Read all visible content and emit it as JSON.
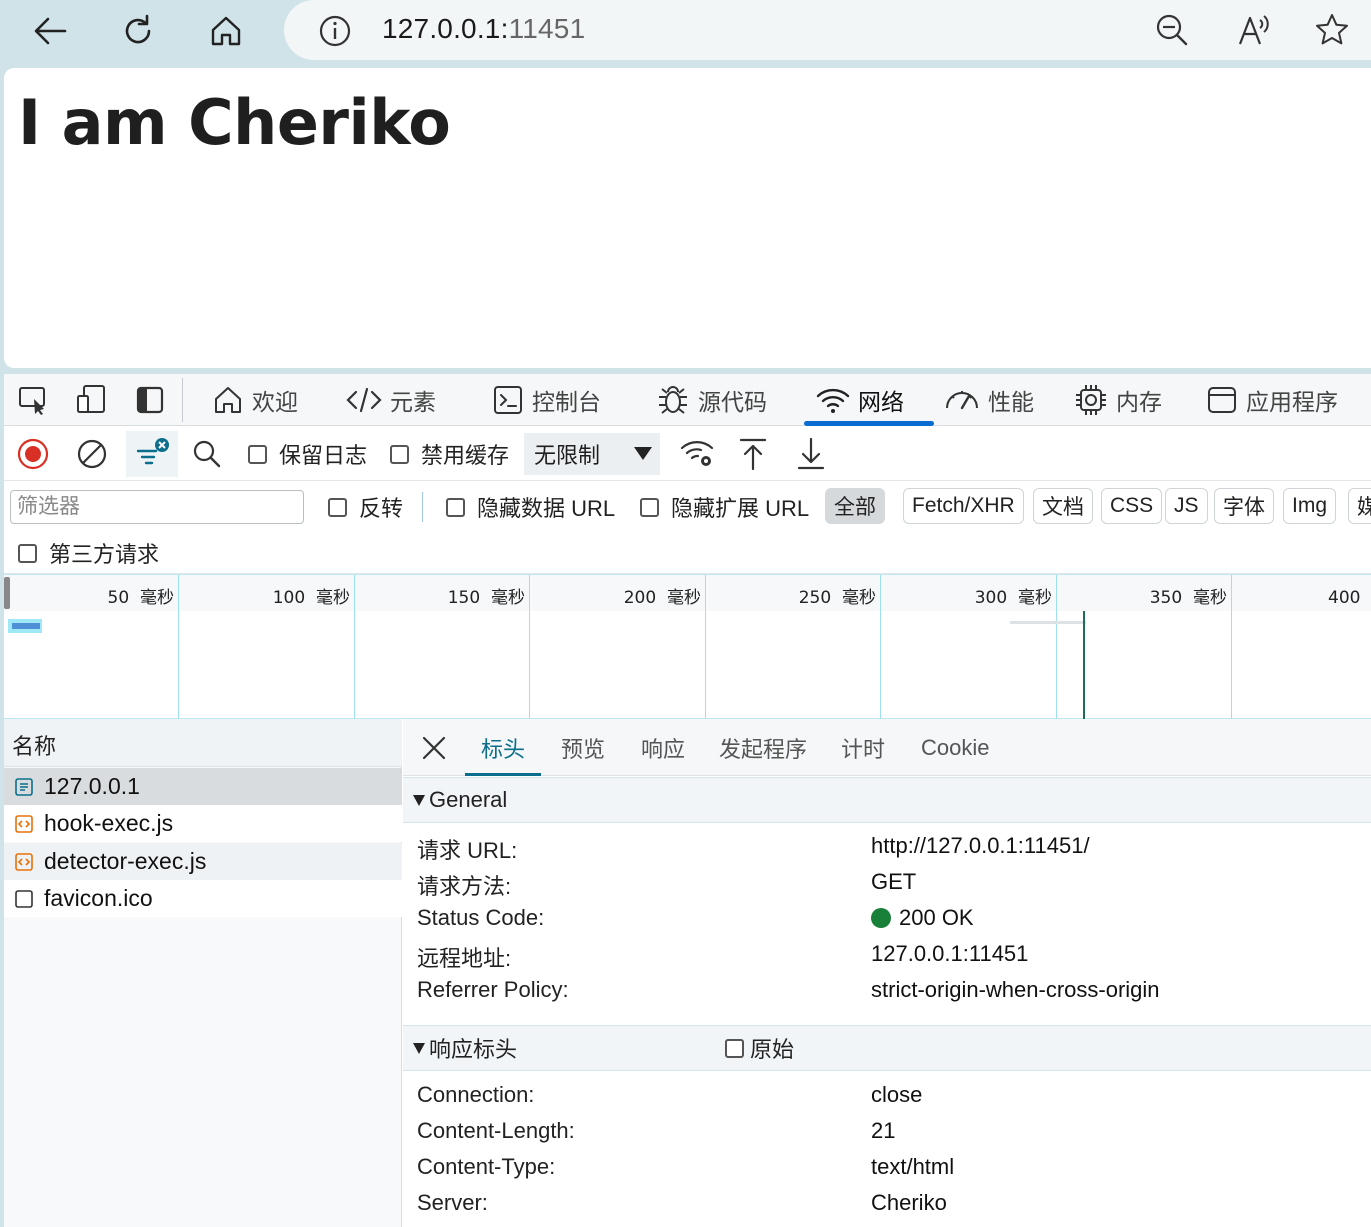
{
  "browser": {
    "url_host": "127.0.0.1:",
    "url_port": "11451"
  },
  "page": {
    "heading": "I am Cheriko"
  },
  "devtools": {
    "tabs": [
      "欢迎",
      "元素",
      "控制台",
      "源代码",
      "网络",
      "性能",
      "内存",
      "应用程序"
    ],
    "toolbar": {
      "preserve_log": "保留日志",
      "disable_cache": "禁用缓存",
      "throttle": "无限制"
    },
    "filter": {
      "placeholder": "筛选器",
      "invert": "反转",
      "hide_data_url": "隐藏数据 URL",
      "hide_ext_url": "隐藏扩展 URL",
      "types": [
        "全部",
        "Fetch/XHR",
        "文档",
        "CSS",
        "JS",
        "字体",
        "Img",
        "媒"
      ],
      "third_party": "第三方请求"
    },
    "overview": {
      "ticks": [
        "50",
        "100",
        "150",
        "200",
        "250",
        "300",
        "350",
        "400"
      ],
      "unit": "毫秒"
    },
    "requests": {
      "header": "名称",
      "rows": [
        "127.0.0.1",
        "hook-exec.js",
        "detector-exec.js",
        "favicon.ico"
      ]
    },
    "details": {
      "tabs": [
        "标头",
        "预览",
        "响应",
        "发起程序",
        "计时",
        "Cookie"
      ],
      "general": {
        "title": "General",
        "rows": [
          {
            "k": "请求 URL:",
            "v": "http://127.0.0.1:11451/"
          },
          {
            "k": "请求方法:",
            "v": "GET"
          },
          {
            "k": "Status Code:",
            "v": "200 OK"
          },
          {
            "k": "远程地址:",
            "v": "127.0.0.1:11451"
          },
          {
            "k": "Referrer Policy:",
            "v": "strict-origin-when-cross-origin"
          }
        ]
      },
      "response_headers": {
        "title": "响应标头",
        "raw": "原始",
        "rows": [
          {
            "k": "Connection:",
            "v": "close"
          },
          {
            "k": "Content-Length:",
            "v": "21"
          },
          {
            "k": "Content-Type:",
            "v": "text/html"
          },
          {
            "k": "Server:",
            "v": "Cheriko"
          }
        ]
      }
    }
  }
}
